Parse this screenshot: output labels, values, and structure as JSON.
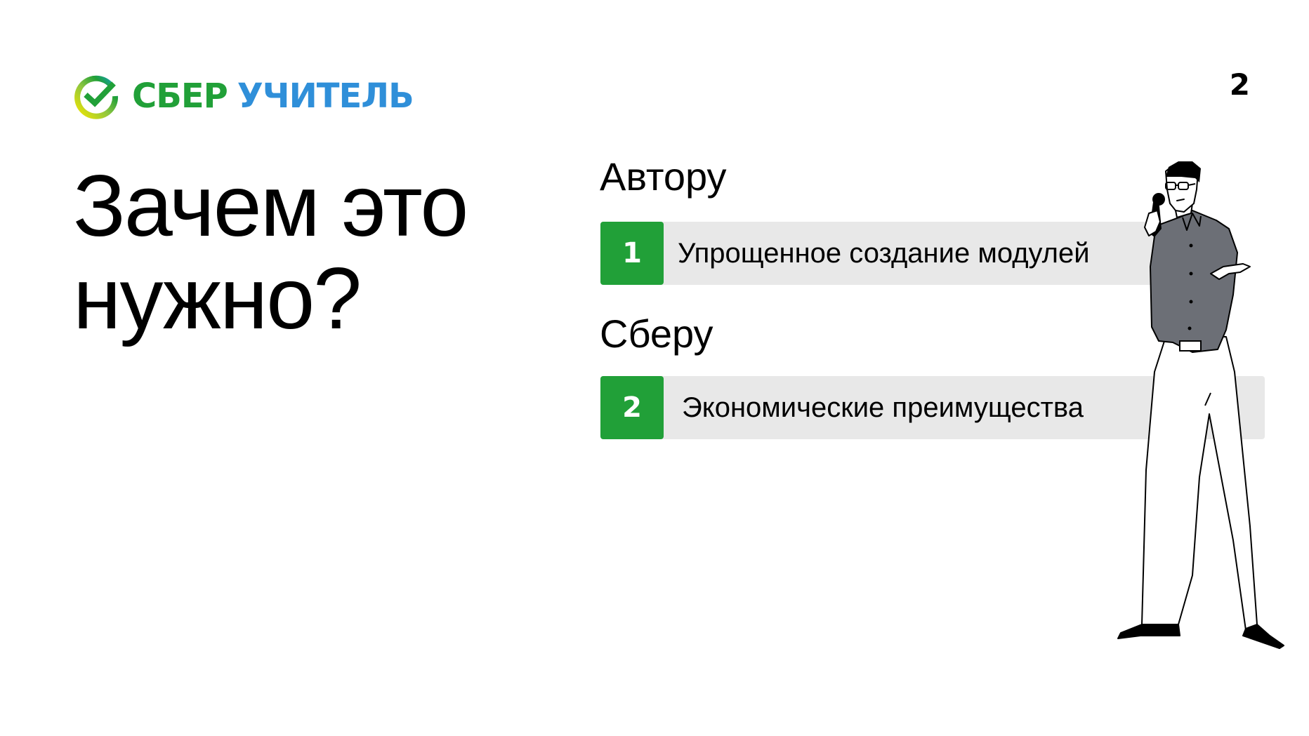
{
  "logo": {
    "brand": "СБЕР",
    "product": "УЧИТЕЛЬ",
    "mark_colors": [
      "#f3e600",
      "#8dc63f",
      "#21a038",
      "#12a0c3"
    ],
    "brand_color": "#21a038",
    "product_color": "#2f8fd9"
  },
  "page_number": "2",
  "title": "Зачем это нужно?",
  "sections": [
    {
      "label": "Автору",
      "item": {
        "number": "1",
        "text": "Упрощенное создание модулей"
      }
    },
    {
      "label": "Сберу",
      "item": {
        "number": "2",
        "text": "Экономические преимущества"
      }
    }
  ],
  "colors": {
    "accent": "#21a038",
    "row_background": "#e8e8e8",
    "shirt": "#6c6f76"
  },
  "illustration": "man-with-microphone"
}
